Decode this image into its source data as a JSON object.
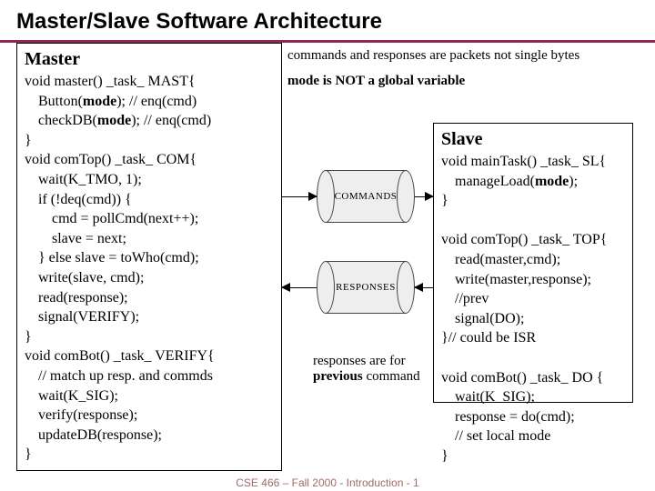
{
  "title": "Master/Slave Software Architecture",
  "notes": {
    "packets": "commands and responses are packets not single bytes",
    "modeglobal": "mode is NOT a global variable",
    "responses1": "responses are for",
    "responses2": "previous",
    "responses3": " command"
  },
  "cylinders": {
    "commands": "COMMANDS",
    "responses": "RESPONSES"
  },
  "master": {
    "head": "Master",
    "l1a": "void master() _task_ MAST{",
    "l2a": "Button(",
    "l2b": "mode",
    "l2c": ");   // enq(cmd)",
    "l3a": "checkDB(",
    "l3b": "mode",
    "l3c": ");  // enq(cmd)",
    "l4": "}",
    "l5": "void comTop() _task_ COM{",
    "l6": "wait(K_TMO, 1);",
    "l7": "if (!deq(cmd)) {",
    "l8": "cmd = pollCmd(next++);",
    "l9": "slave = next;",
    "l10": "} else slave = toWho(cmd);",
    "l11": "write(slave, cmd);",
    "l12": "read(response);",
    "l13": "signal(VERIFY);",
    "l14": "}",
    "l15": "void comBot() _task_ VERIFY{",
    "l16": "// match up resp. and commds",
    "l17": "wait(K_SIG);",
    "l18": "verify(response);",
    "l19": "updateDB(response);",
    "l20": "}"
  },
  "slave": {
    "head": "Slave",
    "l1": "void mainTask() _task_ SL{",
    "l2a": "manageLoad(",
    "l2b": "mode",
    "l2c": ");",
    "l3": "}",
    "l5": "void comTop() _task_ TOP{",
    "l6": "read(master,cmd);",
    "l7": "write(master,response); //prev",
    "l8": "signal(DO);",
    "l9": "}// could be ISR",
    "l11": "void comBot() _task_ DO {",
    "l12": "wait(K_SIG);",
    "l13": "response = do(cmd);",
    "l14": "// set local mode",
    "l15": "}"
  },
  "footer": "CSE 466 – Fall 2000 - Introduction - 1"
}
